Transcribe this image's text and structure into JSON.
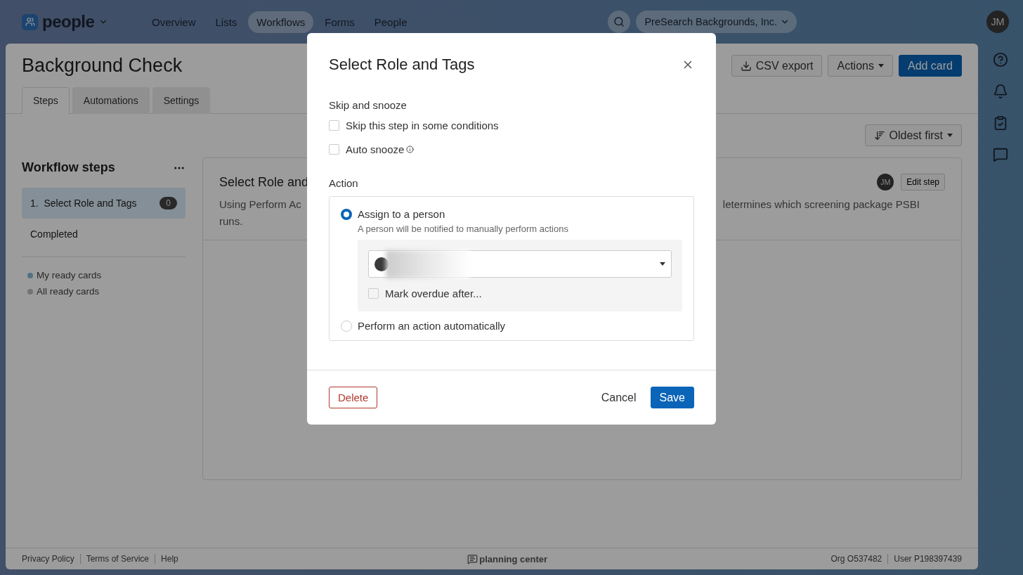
{
  "app_nav": {
    "app_name": "people",
    "items": [
      {
        "label": "Overview",
        "selected": false
      },
      {
        "label": "Lists",
        "selected": false
      },
      {
        "label": "Workflows",
        "selected": true
      },
      {
        "label": "Forms",
        "selected": false
      },
      {
        "label": "People",
        "selected": false
      }
    ],
    "org": "PreSearch Backgrounds, Inc.",
    "avatar": "JM"
  },
  "page": {
    "title": "Background Check",
    "buttons": {
      "csv_export": "CSV export",
      "actions": "Actions",
      "add_card": "Add card"
    },
    "tabs": [
      {
        "label": "Steps",
        "selected": true
      },
      {
        "label": "Automations",
        "selected": false
      },
      {
        "label": "Settings",
        "selected": false
      }
    ],
    "sort": "Oldest first",
    "sidebar": {
      "title": "Workflow steps",
      "steps": [
        {
          "number": "1.",
          "label": "Select Role and Tags",
          "count": "0",
          "selected": true
        },
        {
          "label": "Completed",
          "selected": false
        }
      ],
      "filters": [
        {
          "label": "My ready cards",
          "color": "#527086"
        },
        {
          "label": "All ready cards",
          "color": "#737373"
        }
      ]
    },
    "card": {
      "title": "Select Role and",
      "avatar": "JM",
      "edit": "Edit step",
      "desc_line_1": "Using Perform Ac",
      "desc_line_2": "runs.",
      "desc_right": "letermines which screening package PSBI"
    }
  },
  "footer": {
    "links": [
      "Privacy Policy",
      "Terms of Service",
      "Help"
    ],
    "brand": "planning center",
    "org": "Org O537482",
    "user": "User P198397439"
  },
  "modal": {
    "title": "Select Role and Tags",
    "skip_label": "Skip and snooze",
    "options": [
      {
        "label": "Skip this step in some conditions",
        "checked": false,
        "info": false
      },
      {
        "label": "Auto snooze",
        "checked": false,
        "info": true
      }
    ],
    "action_label": "Action",
    "choices": [
      {
        "label": "Assign to a person",
        "description": "A person will be notified to manually perform actions",
        "selected": true
      },
      {
        "label": "Perform an action automatically",
        "selected": false
      }
    ],
    "overdue": {
      "label": "Mark overdue after...",
      "checked": false
    },
    "buttons": {
      "delete": "Delete",
      "cancel": "Cancel",
      "save": "Save"
    }
  }
}
